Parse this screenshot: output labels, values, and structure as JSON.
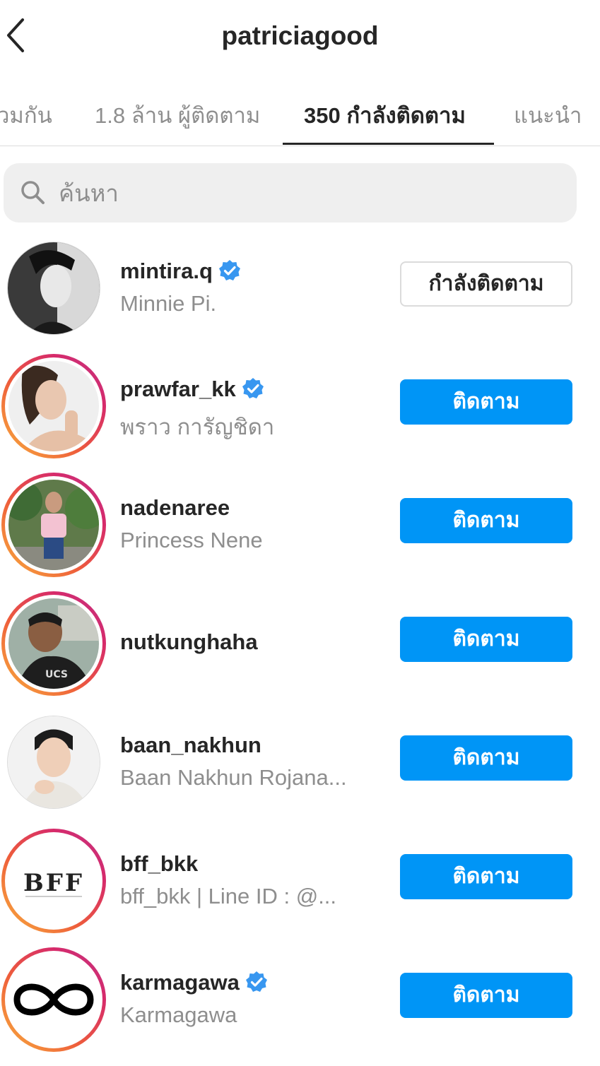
{
  "header": {
    "title": "patriciagood",
    "back_icon": "chevron-left-icon"
  },
  "tabs": [
    {
      "label": "วมกัน",
      "active": false
    },
    {
      "label": "1.8 ล้าน ผู้ติดตาม",
      "active": false
    },
    {
      "label": "350 กำลังติดตาม",
      "active": true
    },
    {
      "label": "แนะนำ",
      "active": false
    }
  ],
  "search": {
    "placeholder": "ค้นหา",
    "icon": "search-icon"
  },
  "accounts": [
    {
      "username": "mintira.q",
      "name": "Minnie Pi.",
      "verified": true,
      "story_ring": false,
      "button": "กำลังติดตาม",
      "following": true
    },
    {
      "username": "prawfar_kk",
      "name": "พราว การัญชิดา",
      "verified": true,
      "story_ring": true,
      "button": "ติดตาม",
      "following": false
    },
    {
      "username": "nadenaree",
      "name": "Princess Nene",
      "verified": false,
      "story_ring": true,
      "button": "ติดตาม",
      "following": false
    },
    {
      "username": "nutkunghaha",
      "name": "",
      "verified": false,
      "story_ring": true,
      "button": "ติดตาม",
      "following": false
    },
    {
      "username": "baan_nakhun",
      "name": "Baan Nakhun Rojana...",
      "verified": false,
      "story_ring": false,
      "button": "ติดตาม",
      "following": false
    },
    {
      "username": "bff_bkk",
      "name": "bff_bkk | Line ID : @...",
      "verified": false,
      "story_ring": true,
      "button": "ติดตาม",
      "following": false,
      "logo_text": "BFF"
    },
    {
      "username": "karmagawa",
      "name": "Karmagawa",
      "verified": true,
      "story_ring": true,
      "button": "ติดตาม",
      "following": false
    }
  ],
  "colors": {
    "follow_button": "#0095f6",
    "verified_badge": "#3897f0",
    "secondary_text": "#8e8e8e",
    "primary_text": "#262626"
  }
}
